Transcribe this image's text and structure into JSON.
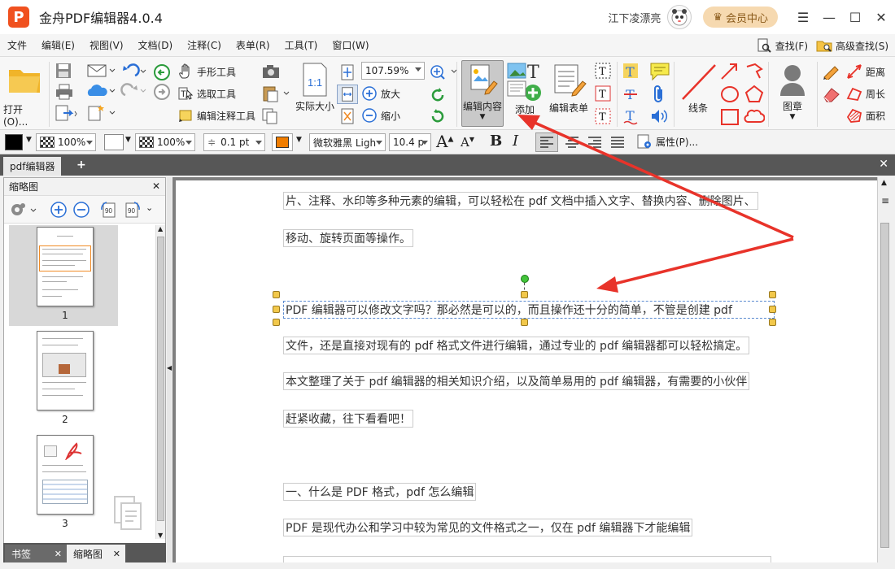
{
  "titlebar": {
    "app_title": "金舟PDF编辑器4.0.4",
    "user_name": "江下凌漂亮",
    "member_label": "会员中心"
  },
  "menu": {
    "items": [
      "文件",
      "编辑(E)",
      "视图(V)",
      "文档(D)",
      "注释(C)",
      "表单(R)",
      "工具(T)",
      "窗口(W)"
    ],
    "find_label": "查找(F)",
    "advanced_find_label": "高级查找(S)"
  },
  "ribbon": {
    "open_label": "打开(O)...",
    "hand_tool": "手形工具",
    "select_tool": "选取工具",
    "edit_annotation_tool": "编辑注释工具",
    "actual_size": "实际大小",
    "zoom_value": "107.59%",
    "zoom_in": "放大",
    "zoom_out": "缩小",
    "edit_content": "编辑内容",
    "add": "添加",
    "edit_form": "编辑表单",
    "lines": "线条",
    "stamp": "图章",
    "distance": "距离",
    "perimeter": "周长",
    "area": "面积"
  },
  "formatbar": {
    "fill_opacity": "100%",
    "stroke_opacity": "100%",
    "line_width": "0.1 pt",
    "font_name": "微软雅黑 Ligh",
    "font_size": "10.4 p",
    "properties": "属性(P)..."
  },
  "doc_tab": {
    "label": "pdf编辑器"
  },
  "left_panel": {
    "title": "缩略图",
    "pages": [
      "1",
      "2",
      "3"
    ],
    "bottom_tabs": [
      "书签",
      "缩略图"
    ]
  },
  "document": {
    "paragraphs": [
      "片、注释、水印等多种元素的编辑，可以轻松在 pdf 文档中插入文字、替换内容、删除图片、",
      "移动、旋转页面等操作。",
      "PDF 编辑器可以修改文字吗？那必然是可以的，而且操作还十分的简单，不管是创建 pdf",
      "文件，还是直接对现有的 pdf 格式文件进行编辑，通过专业的 pdf 编辑器都可以轻松搞定。",
      "本文整理了关于 pdf 编辑器的相关知识介绍，以及简单易用的 pdf 编辑器，有需要的小伙伴",
      "赶紧收藏，往下看看吧！",
      "一、什么是 PDF 格式，pdf 怎么编辑",
      "PDF 是现代办公和学习中较为常见的文件格式之一，仅在 pdf 编辑器下才能编辑"
    ]
  },
  "colors": {
    "accent_red": "#e8332a",
    "brand_orange": "#f0511f",
    "member_bg": "#f6d9b0"
  }
}
